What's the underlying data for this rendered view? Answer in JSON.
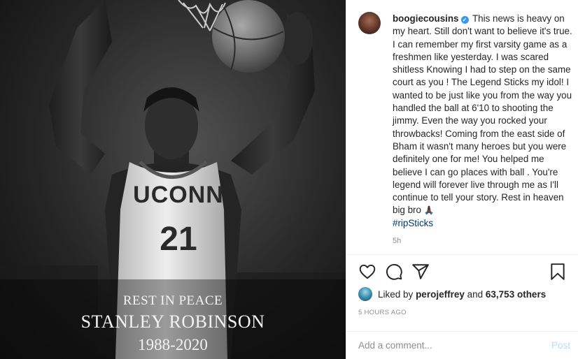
{
  "photo": {
    "jersey_school": "UCONN",
    "jersey_number": "21",
    "overlay": {
      "rip": "REST IN PEACE",
      "name": "STANLEY ROBINSON",
      "years": "1988-2020"
    }
  },
  "post": {
    "username": "boogiecousins",
    "verified": true,
    "caption": "This news is heavy on my heart. Still don't want to believe it's true. I can remember my first varsity game as a freshmen like yesterday. I was scared shitless Knowing I had to step on the same court as you ! The Legend Sticks my idol! I wanted to be just like you from the way you handled the ball at 6'10 to shooting the jimmy. Even the way you rocked your throwbacks! Coming from the east side of Bham it wasn't many heroes but you were definitely one for me! You helped me believe I can go places with ball . You're legend will forever live through me as I'll continue to tell your story. Rest in heaven big bro",
    "emoji": "🙏🏿",
    "hashtag": "#ripSticks",
    "age": "5h"
  },
  "actions": {
    "icons": [
      "heart-icon",
      "comment-icon",
      "share-icon",
      "bookmark-icon"
    ]
  },
  "likes": {
    "prefix": "Liked by",
    "liker": "perojeffrey",
    "conjunction": "and",
    "others": "63,753 others"
  },
  "timestamp": "5 HOURS AGO",
  "comment_box": {
    "placeholder": "Add a comment...",
    "post_label": "Post"
  },
  "colors": {
    "link_blue": "#00376b",
    "verified_blue": "#3897f0",
    "post_button_disabled": "#b2dffc",
    "muted_gray": "#8e8e8e"
  }
}
